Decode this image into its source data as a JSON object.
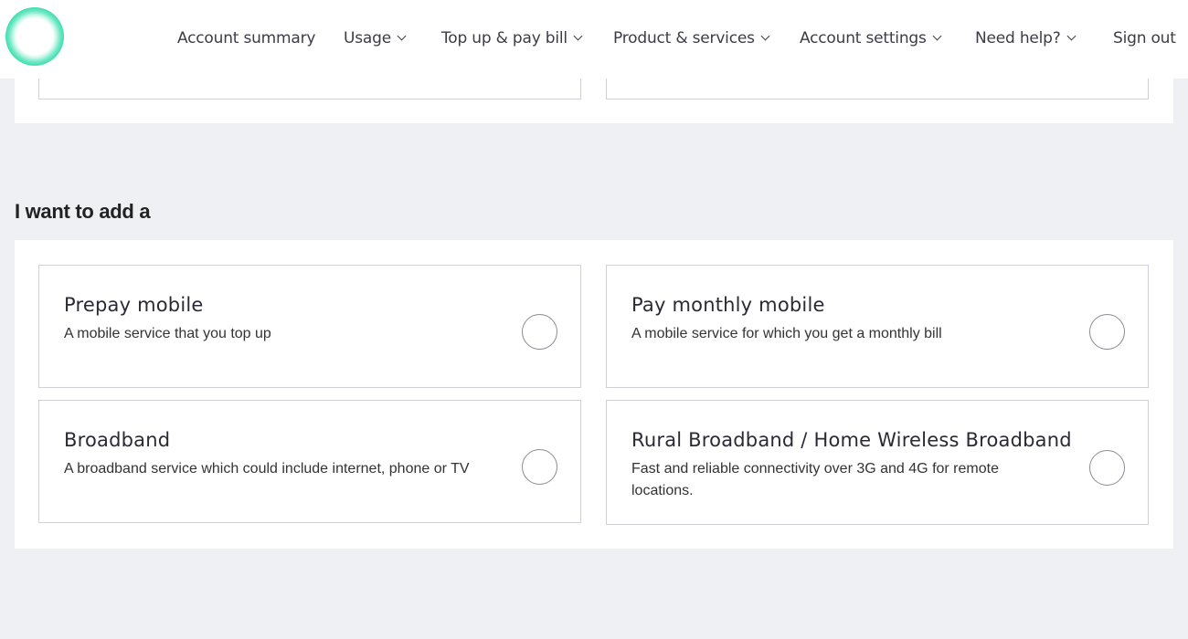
{
  "header": {
    "logo": "brand-logo-ring",
    "nav": [
      {
        "label": "Account summary",
        "dropdown": false
      },
      {
        "label": "Usage",
        "dropdown": true
      },
      {
        "label": "Top up & pay bill",
        "dropdown": true
      },
      {
        "label": "Product & services",
        "dropdown": true
      },
      {
        "label": "Account settings",
        "dropdown": true
      },
      {
        "label": "Need help?",
        "dropdown": true
      },
      {
        "label": "Sign out",
        "dropdown": false
      }
    ]
  },
  "section": {
    "title": "I want to add a"
  },
  "options": [
    {
      "title": "Prepay mobile",
      "description": "A mobile service that you top up",
      "selected": false
    },
    {
      "title": "Pay monthly mobile",
      "description": "A mobile service for which you get a monthly bill",
      "selected": false
    },
    {
      "title": "Broadband",
      "description": "A broadband service which could include internet, phone or TV",
      "selected": false
    },
    {
      "title": "Rural Broadband / Home Wireless Broadband",
      "description": "Fast and reliable connectivity over 3G and 4G for remote locations.",
      "selected": false
    }
  ],
  "colors": {
    "background": "#eef0f4",
    "card_border": "#cfd1d6",
    "brand_green": "#1fd39a"
  }
}
